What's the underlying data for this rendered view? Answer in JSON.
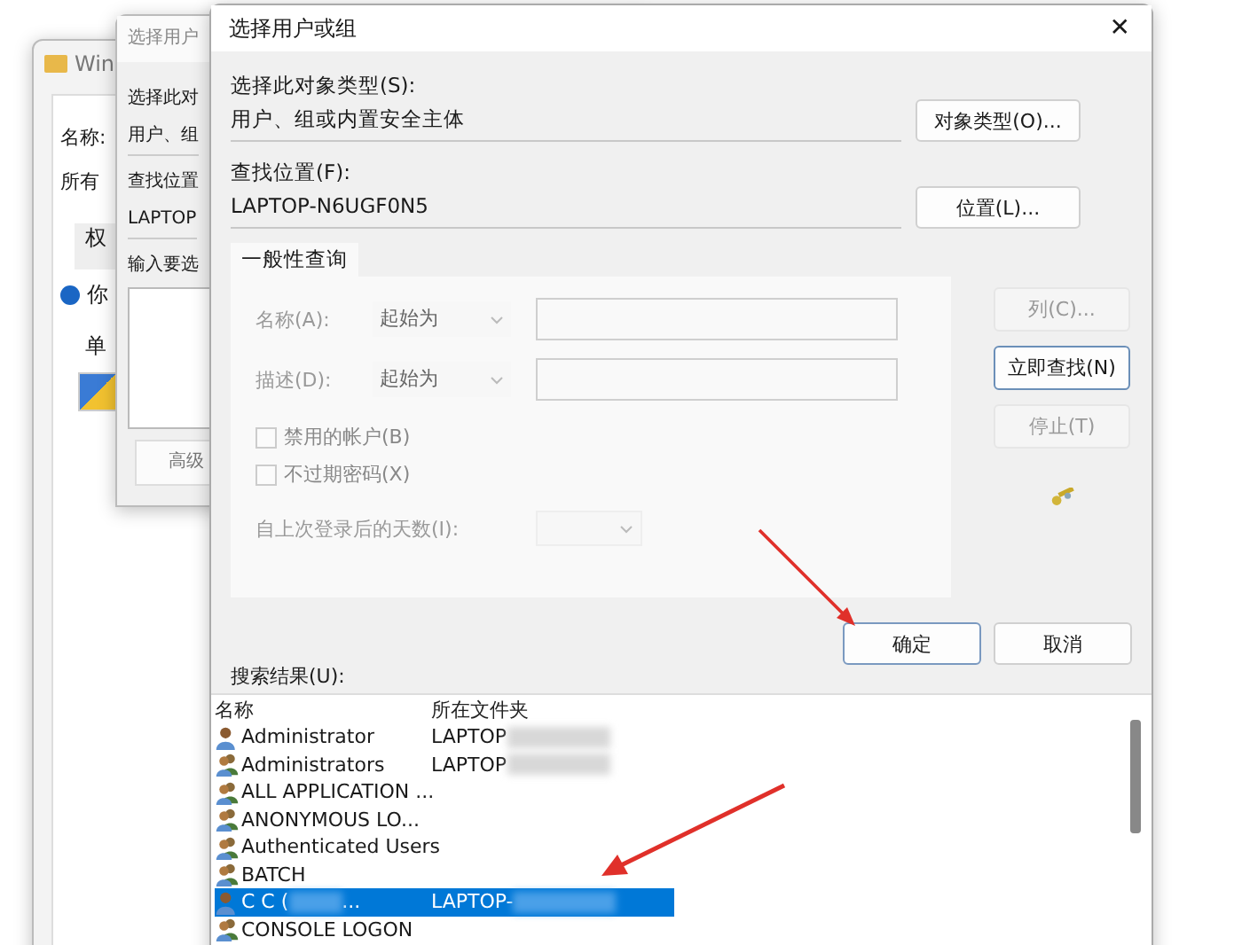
{
  "back_window": {
    "title": "Win",
    "lines": [
      "名称:",
      "所有"
    ],
    "tab": "权",
    "info": "你",
    "item": "单"
  },
  "middle_dialog": {
    "title": "选择用户",
    "type_label": "选择此对",
    "type_value": "用户、组",
    "location_label": "查找位置",
    "location_value": "LAPTOP",
    "enter_label": "输入要选",
    "advanced_button": "高级"
  },
  "window": {
    "title": "选择用户或组",
    "close": "✕"
  },
  "object_type": {
    "label": "选择此对象类型(S):",
    "value": "用户、组或内置安全主体",
    "button": "对象类型(O)..."
  },
  "location": {
    "label": "查找位置(F):",
    "value": "LAPTOP-N6UGF0N5",
    "button": "位置(L)..."
  },
  "tabs": [
    {
      "label": "一般性查询",
      "selected": true
    }
  ],
  "query": {
    "name_label": "名称(A):",
    "name_mode": "起始为",
    "desc_label": "描述(D):",
    "desc_mode": "起始为",
    "checkboxes": [
      {
        "label": "禁用的帐户(B)",
        "checked": false,
        "disabled": true
      },
      {
        "label": "不过期密码(X)",
        "checked": false,
        "disabled": true
      }
    ],
    "days_label": "自上次登录后的天数(I):"
  },
  "side_buttons": [
    {
      "label": "列(C)...",
      "disabled": true
    },
    {
      "label": "立即查找(N)",
      "disabled": false
    },
    {
      "label": "停止(T)",
      "disabled": true
    }
  ],
  "ok_button": "确定",
  "cancel_button": "取消",
  "results": {
    "label": "搜索结果(U):",
    "columns": [
      "名称",
      "所在文件夹"
    ],
    "rows": [
      {
        "kind": "user",
        "name": "Administrator",
        "folder": "LAPTOP",
        "blurred": true,
        "selected": false
      },
      {
        "kind": "group",
        "name": "Administrators",
        "folder": "LAPTOP",
        "blurred": true,
        "selected": false
      },
      {
        "kind": "group",
        "name": "ALL APPLICATION ...",
        "selected": false
      },
      {
        "kind": "group",
        "name": "ANONYMOUS LO...",
        "selected": false
      },
      {
        "kind": "group",
        "name": "Authenticated Users",
        "selected": false
      },
      {
        "kind": "group",
        "name": "BATCH",
        "selected": false
      },
      {
        "kind": "user",
        "name": "C C (",
        "name_end": "...",
        "folder": "LAPTOP-",
        "blurred": true,
        "selected": true
      },
      {
        "kind": "group",
        "name": "CONSOLE LOGON",
        "selected": false
      }
    ]
  }
}
